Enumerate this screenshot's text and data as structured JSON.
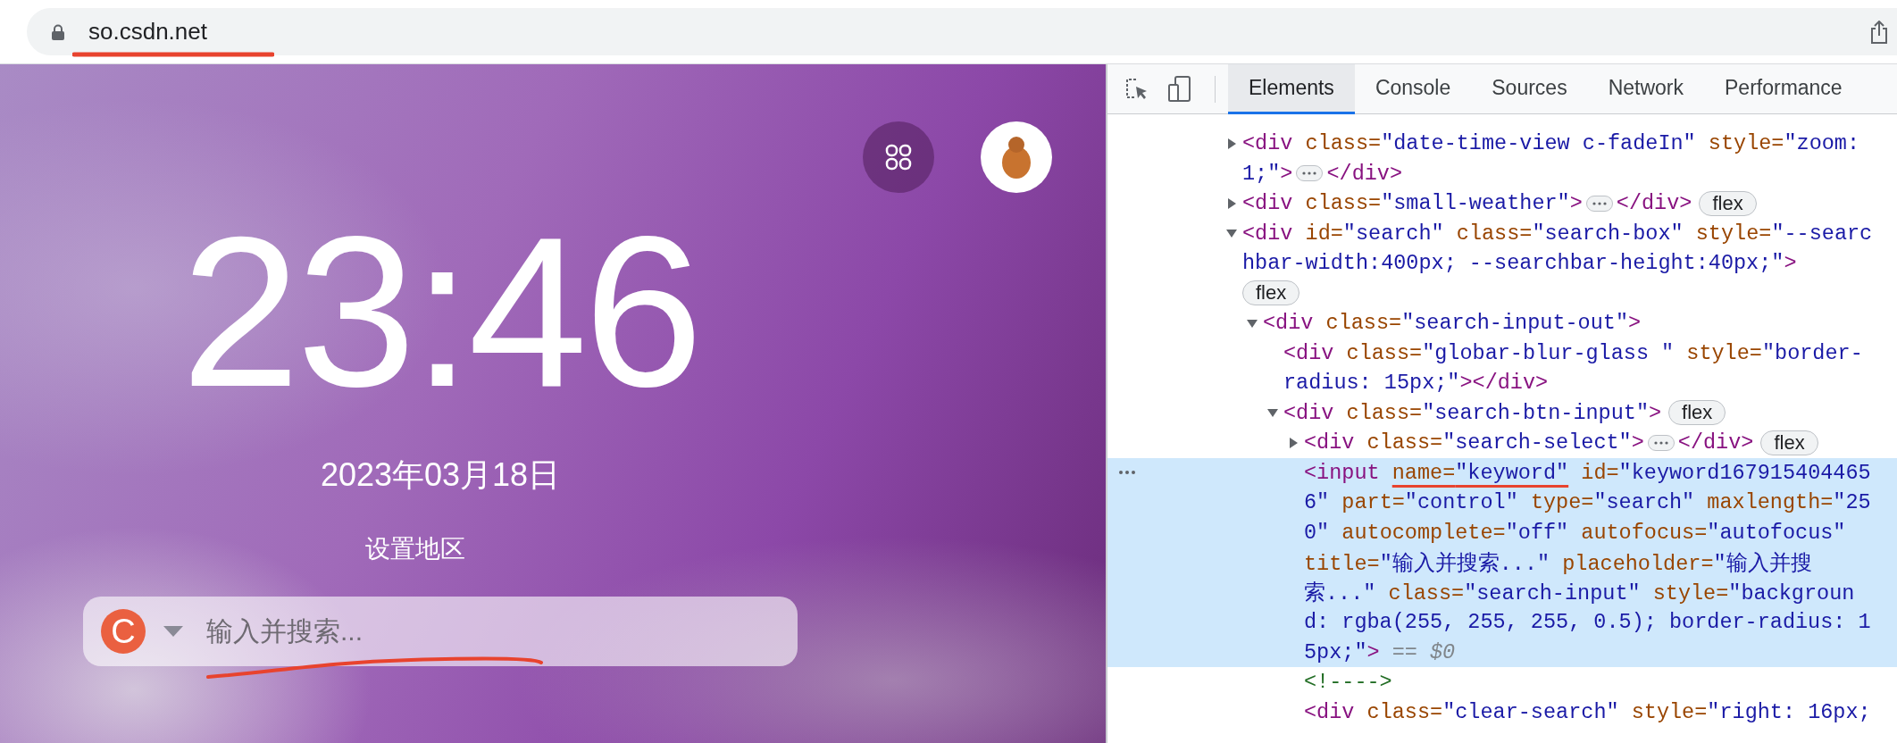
{
  "address_bar": {
    "url": "so.csdn.net"
  },
  "page": {
    "time": "23:46",
    "date": "2023年03月18日",
    "location_link": "设置地区",
    "search": {
      "engine_letter": "C",
      "placeholder": "输入并搜索..."
    }
  },
  "devtools": {
    "tabs": [
      {
        "label": "Elements",
        "selected": true
      },
      {
        "label": "Console",
        "selected": false
      },
      {
        "label": "Sources",
        "selected": false
      },
      {
        "label": "Network",
        "selected": false
      },
      {
        "label": "Performance",
        "selected": false
      }
    ],
    "dom_tree": [
      {
        "kind": "element",
        "selected": false,
        "expanded": false,
        "lines": [
          "<div class=\"date-time-view c-fadeIn\" style=\"zoom:",
          "1;\">"
        ],
        "close": "</div>"
      },
      {
        "kind": "element",
        "selected": false,
        "expanded": false,
        "lines": [
          "<div class=\"small-weather\">"
        ],
        "close": "</div>",
        "badge": "flex"
      },
      {
        "kind": "element",
        "selected": false,
        "expanded": true,
        "lines": [
          "<div id=\"search\" class=\"search-box\" style=\"--searc",
          "hbar-width:400px; --searchbar-height:40px;\">"
        ],
        "badge": "flex",
        "badge_on_own_line": true,
        "children": [
          {
            "kind": "element",
            "selected": false,
            "expanded": true,
            "lines": [
              "<div class=\"search-input-out\">"
            ],
            "children": [
              {
                "kind": "element",
                "selected": false,
                "lines": [
                  "<div class=\"globar-blur-glass \" style=\"border-",
                  "radius: 15px;\"></div>"
                ]
              },
              {
                "kind": "element",
                "selected": false,
                "expanded": true,
                "lines": [
                  "<div class=\"search-btn-input\">"
                ],
                "badge": "flex",
                "children": [
                  {
                    "kind": "element",
                    "selected": false,
                    "expanded": false,
                    "lines": [
                      "<div class=\"search-select\">"
                    ],
                    "close": "</div>",
                    "badge": "flex"
                  },
                  {
                    "kind": "element",
                    "selected": true,
                    "lines": [
                      [
                        {
                          "text": "<input "
                        },
                        {
                          "text": "name=\"keyword\"",
                          "underlined": true
                        },
                        {
                          "text": " id=\"keyword167915404465"
                        }
                      ],
                      "6\" part=\"control\" type=\"search\" maxlength=\"25",
                      "0\" autocomplete=\"off\" autofocus=\"autofocus\"",
                      "title=\"输入并搜索...\" placeholder=\"输入并搜",
                      "索...\" class=\"search-input\" style=\"backgroun",
                      "d: rgba(255, 255, 255, 0.5); border-radius: 1",
                      "5px;\">"
                    ],
                    "suffix": "== $0"
                  },
                  {
                    "kind": "comment",
                    "selected": false,
                    "lines": [
                      "<!---->"
                    ]
                  },
                  {
                    "kind": "element",
                    "selected": false,
                    "lines": [
                      "<div class=\"clear-search\" style=\"right: 16px;"
                    ]
                  }
                ]
              }
            ]
          }
        ]
      }
    ]
  }
}
